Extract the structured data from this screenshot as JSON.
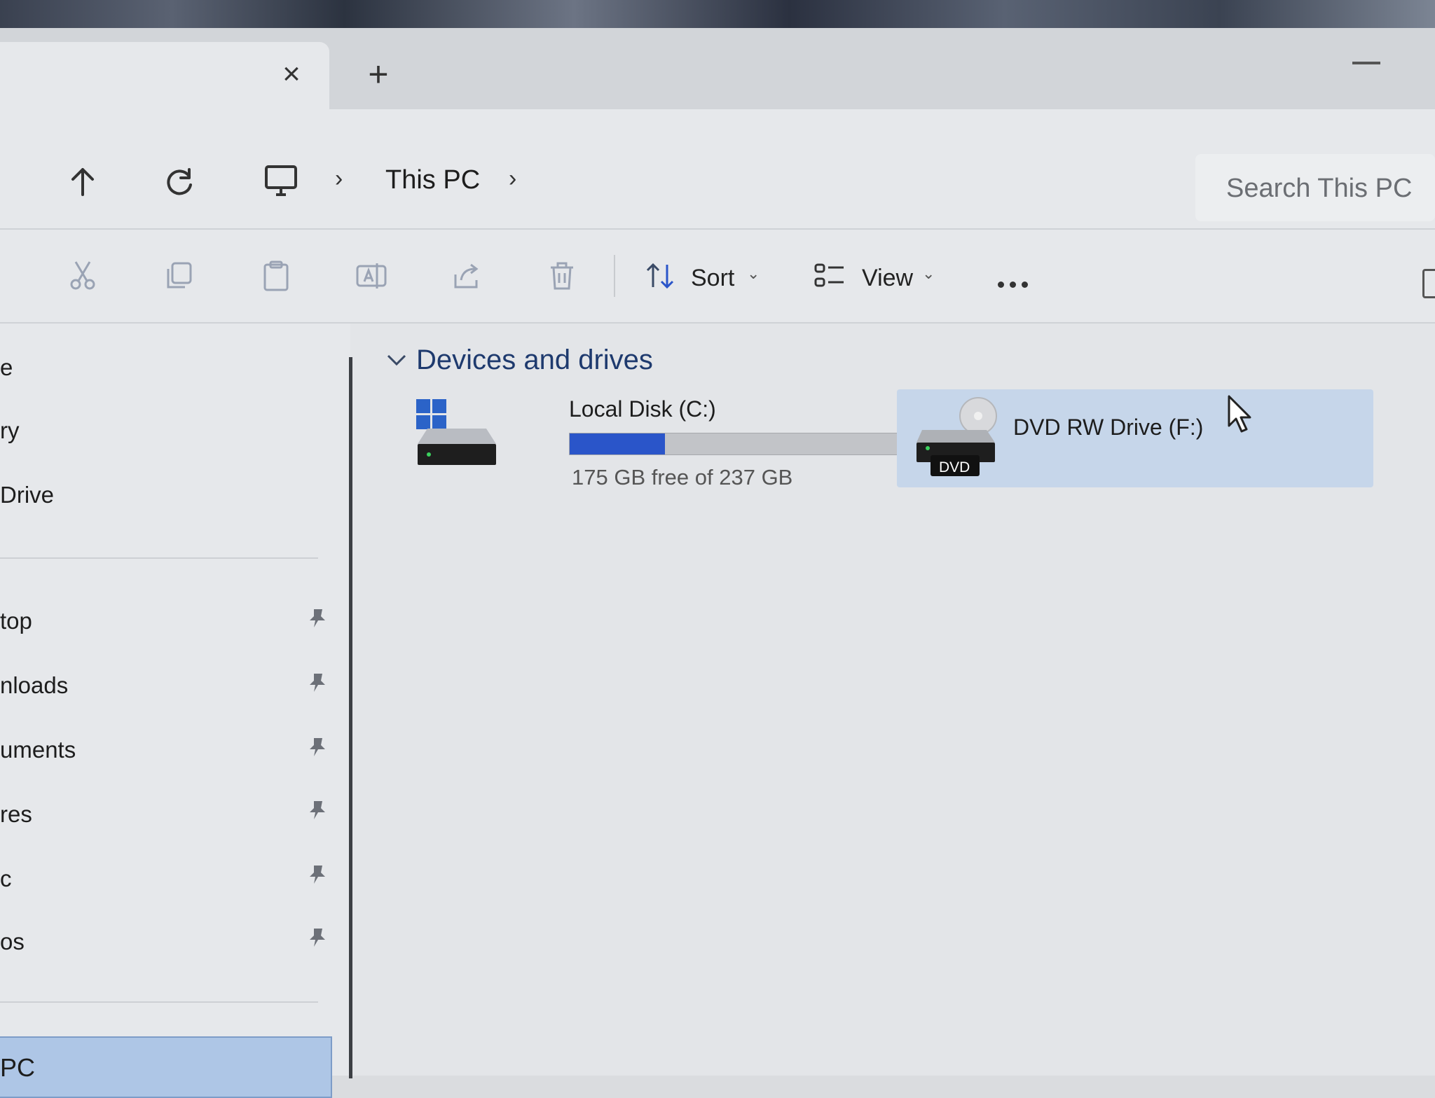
{
  "tabbar": {
    "close_icon": "close-icon",
    "new_tab_icon": "plus-icon"
  },
  "address": {
    "breadcrumb": [
      "This PC"
    ],
    "search_placeholder": "Search This PC"
  },
  "commandbar": {
    "sort_label": "Sort",
    "view_label": "View"
  },
  "sidebar": {
    "items": [
      {
        "label": "e"
      },
      {
        "label": "ry"
      },
      {
        "label": "Drive"
      },
      {
        "label": "top",
        "pinned": true
      },
      {
        "label": "nloads",
        "pinned": true
      },
      {
        "label": "uments",
        "pinned": true
      },
      {
        "label": "res",
        "pinned": true
      },
      {
        "label": "c",
        "pinned": true
      },
      {
        "label": "os",
        "pinned": true
      }
    ],
    "selected_label": "PC"
  },
  "content": {
    "group_title": "Devices and drives",
    "drives": [
      {
        "name": "Local Disk (C:)",
        "free_text": "175 GB free of 237 GB",
        "used_fraction": 0.26
      },
      {
        "name": "DVD RW Drive (F:)",
        "badge": "DVD"
      }
    ]
  },
  "colors": {
    "accent": "#2a55c9",
    "selection": "#c6d6ea",
    "sidebar_selected": "#aec6e6",
    "group_title": "#1e3a6e"
  }
}
